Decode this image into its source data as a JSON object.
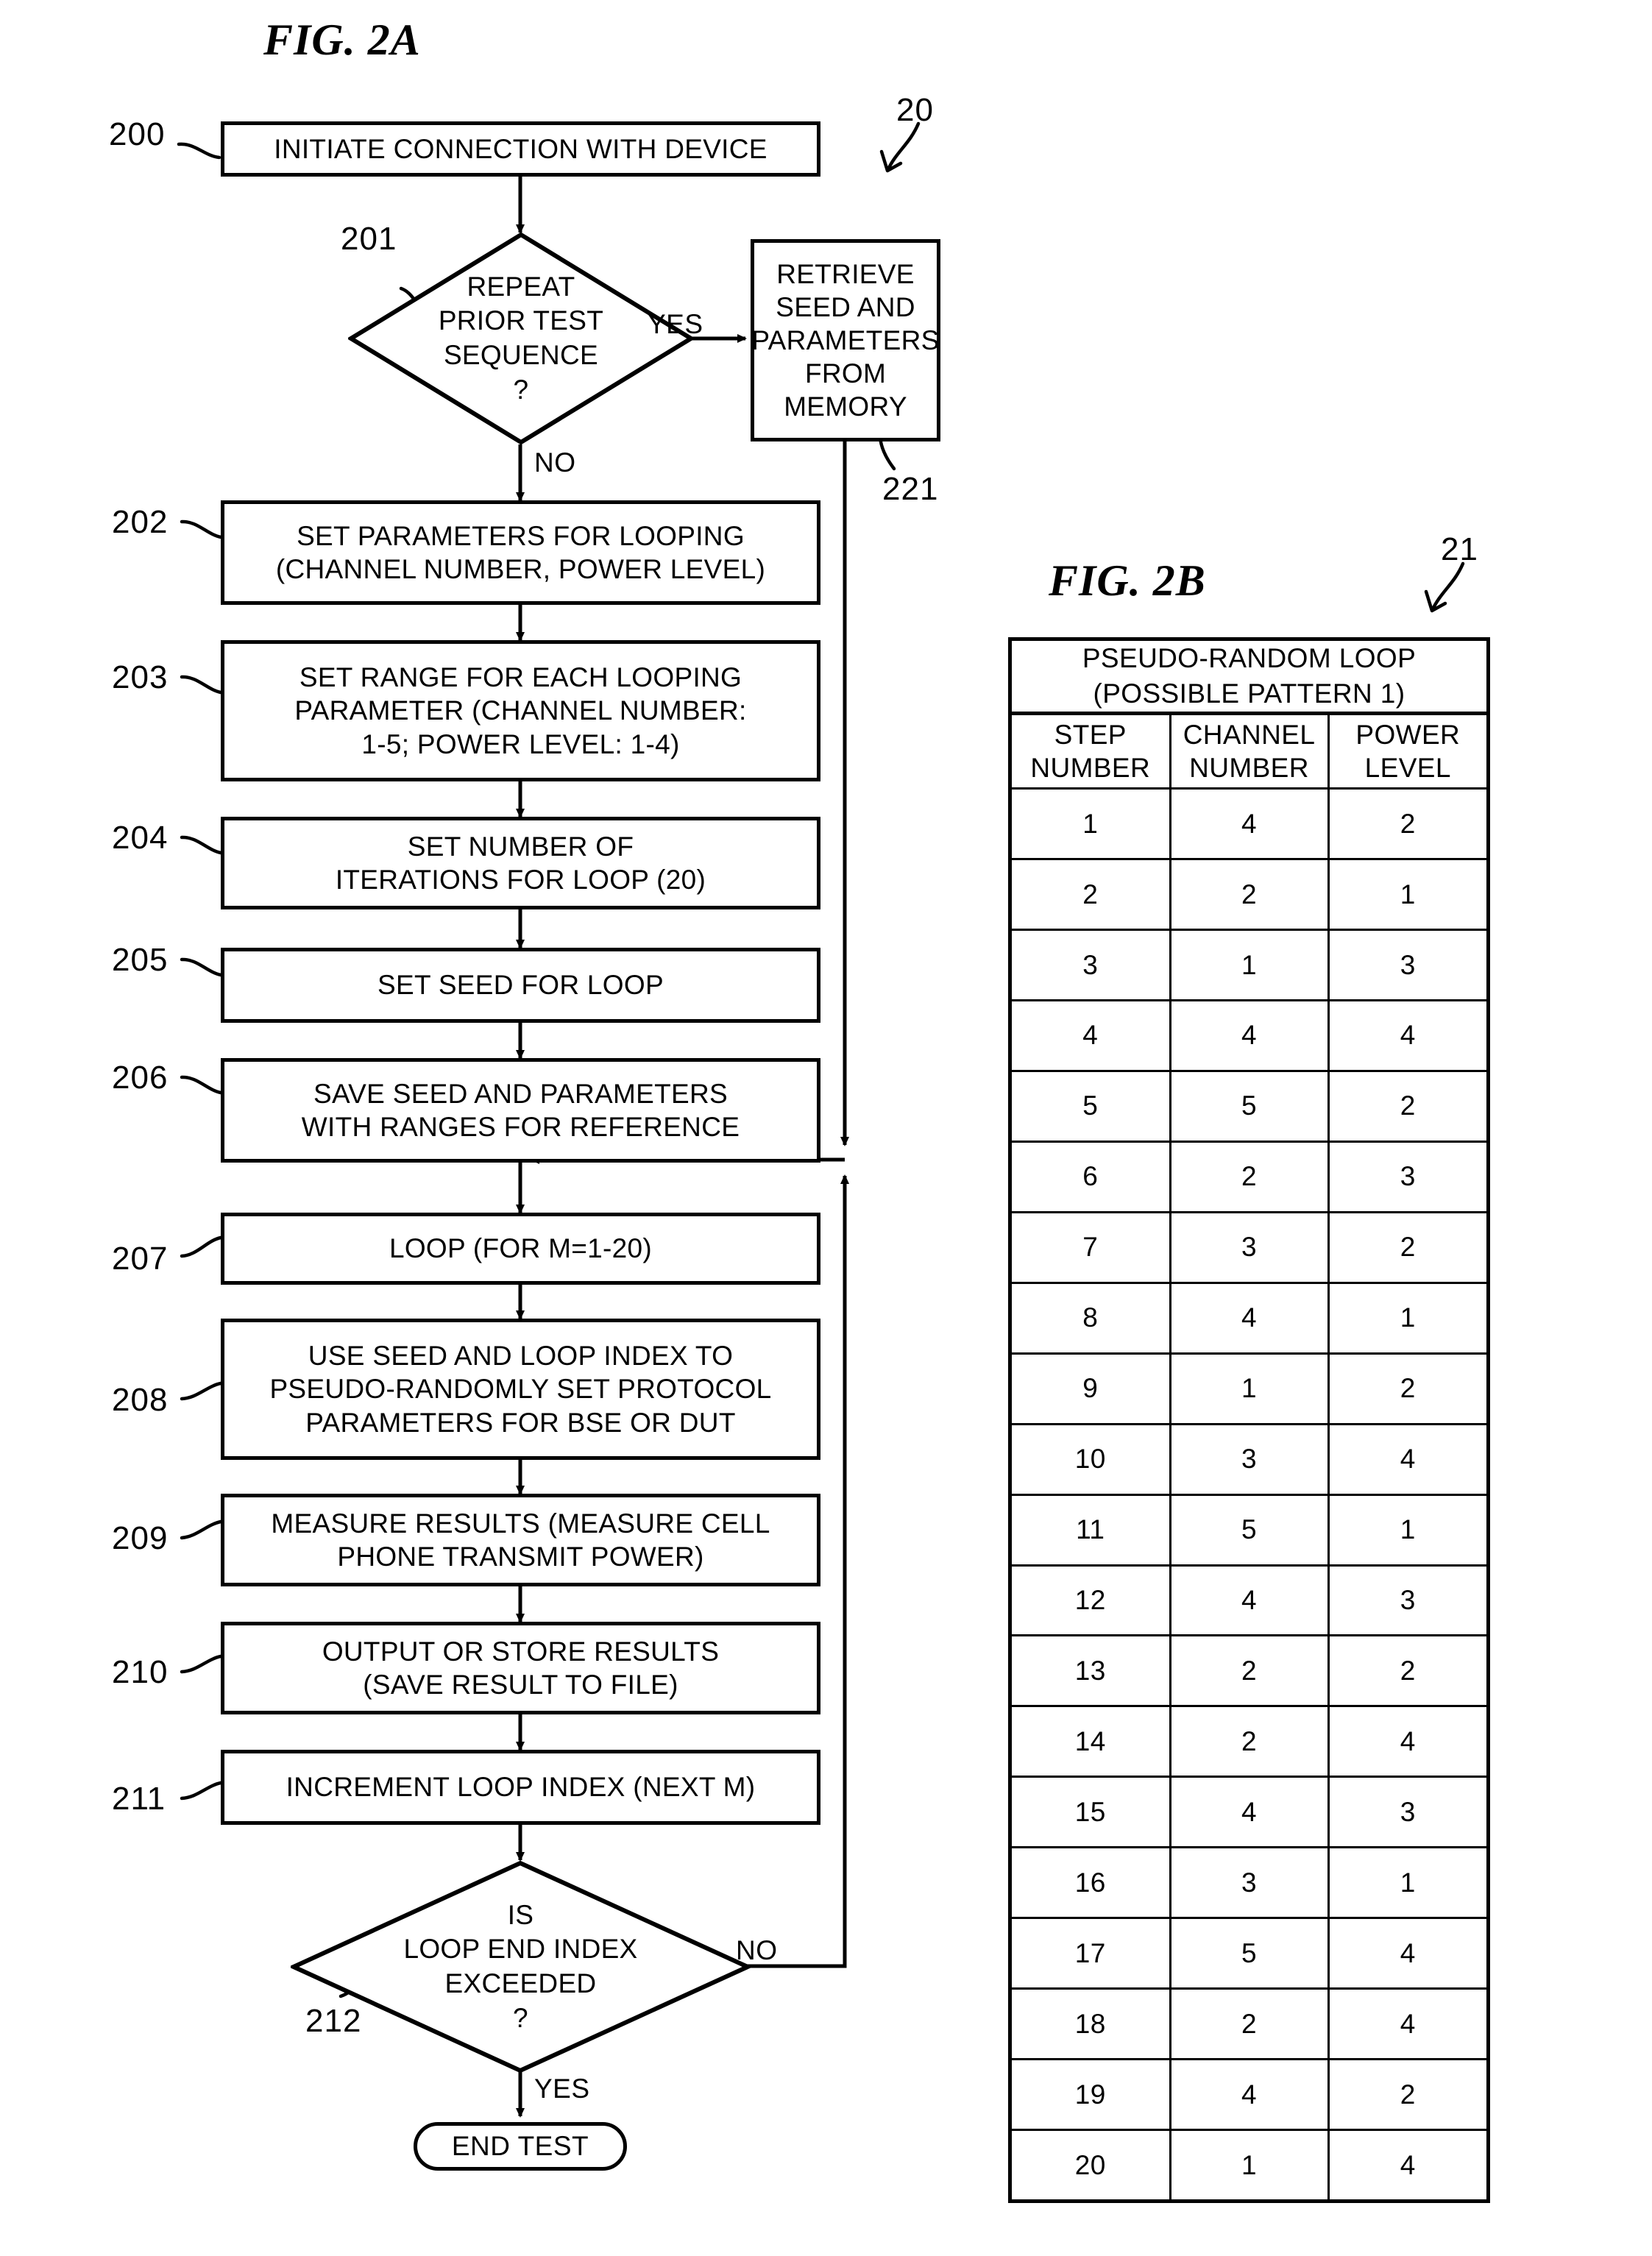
{
  "figures": {
    "fig_a": {
      "title": "FIG. 2A",
      "ref": "20"
    },
    "fig_b": {
      "title": "FIG. 2B",
      "ref": "21"
    }
  },
  "flowchart": {
    "nodes": {
      "n200": {
        "ref": "200",
        "text": "INITIATE CONNECTION WITH DEVICE"
      },
      "n201": {
        "ref": "201",
        "text": "REPEAT\nPRIOR TEST\nSEQUENCE\n?"
      },
      "n221": {
        "ref": "221",
        "text": "RETRIEVE\nSEED AND\nPARAMETERS\nFROM\nMEMORY"
      },
      "n202": {
        "ref": "202",
        "text": "SET PARAMETERS FOR LOOPING\n(CHANNEL NUMBER, POWER LEVEL)"
      },
      "n203": {
        "ref": "203",
        "text": "SET RANGE FOR EACH LOOPING\nPARAMETER (CHANNEL NUMBER:\n1-5; POWER LEVEL: 1-4)"
      },
      "n204": {
        "ref": "204",
        "text": "SET NUMBER OF\nITERATIONS FOR LOOP (20)"
      },
      "n205": {
        "ref": "205",
        "text": "SET SEED FOR LOOP"
      },
      "n206": {
        "ref": "206",
        "text": "SAVE SEED AND PARAMETERS\nWITH RANGES FOR REFERENCE"
      },
      "n207": {
        "ref": "207",
        "text": "LOOP (FOR M=1-20)"
      },
      "n208": {
        "ref": "208",
        "text": "USE SEED AND LOOP INDEX TO\nPSEUDO-RANDOMLY SET PROTOCOL\nPARAMETERS FOR BSE OR DUT"
      },
      "n209": {
        "ref": "209",
        "text": "MEASURE RESULTS (MEASURE CELL\nPHONE TRANSMIT POWER)"
      },
      "n210": {
        "ref": "210",
        "text": "OUTPUT OR STORE RESULTS\n(SAVE RESULT TO FILE)"
      },
      "n211": {
        "ref": "211",
        "text": "INCREMENT LOOP INDEX (NEXT M)"
      },
      "n212": {
        "ref": "212",
        "text": "IS\nLOOP END INDEX\nEXCEEDED\n?"
      },
      "n213": {
        "text": "END TEST"
      }
    },
    "branches": {
      "yes_201": "YES",
      "no_201": "NO",
      "no_212": "NO",
      "yes_212": "YES"
    }
  },
  "chart_data": {
    "type": "table",
    "title": "PSEUDO-RANDOM LOOP\n(POSSIBLE PATTERN 1)",
    "columns": [
      "STEP\nNUMBER",
      "CHANNEL\nNUMBER",
      "POWER\nLEVEL"
    ],
    "rows": [
      [
        "1",
        "4",
        "2"
      ],
      [
        "2",
        "2",
        "1"
      ],
      [
        "3",
        "1",
        "3"
      ],
      [
        "4",
        "4",
        "4"
      ],
      [
        "5",
        "5",
        "2"
      ],
      [
        "6",
        "2",
        "3"
      ],
      [
        "7",
        "3",
        "2"
      ],
      [
        "8",
        "4",
        "1"
      ],
      [
        "9",
        "1",
        "2"
      ],
      [
        "10",
        "3",
        "4"
      ],
      [
        "11",
        "5",
        "1"
      ],
      [
        "12",
        "4",
        "3"
      ],
      [
        "13",
        "2",
        "2"
      ],
      [
        "14",
        "2",
        "4"
      ],
      [
        "15",
        "4",
        "3"
      ],
      [
        "16",
        "3",
        "1"
      ],
      [
        "17",
        "5",
        "4"
      ],
      [
        "18",
        "2",
        "4"
      ],
      [
        "19",
        "4",
        "2"
      ],
      [
        "20",
        "1",
        "4"
      ]
    ]
  }
}
